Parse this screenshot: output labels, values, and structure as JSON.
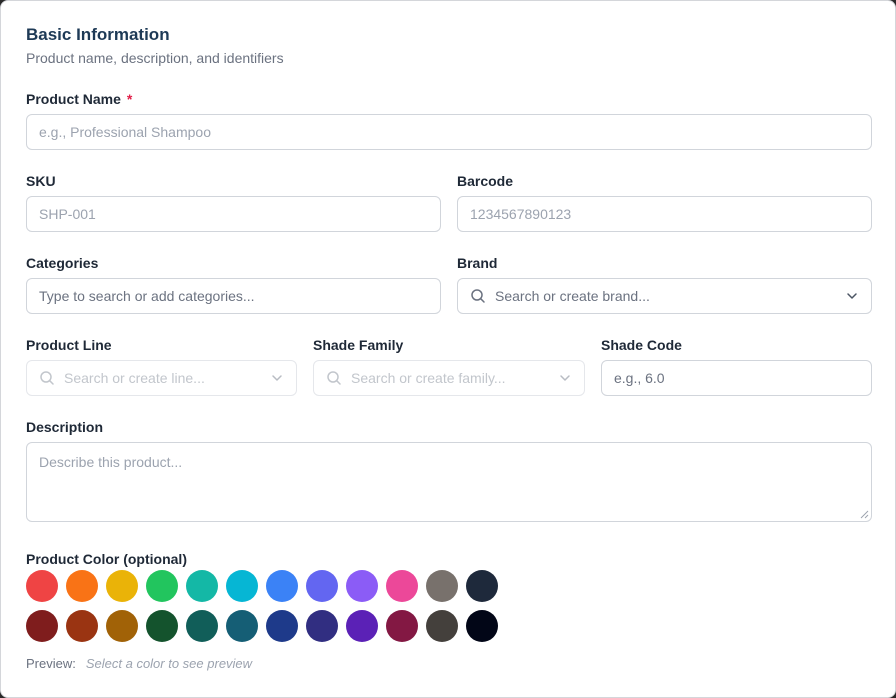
{
  "section": {
    "title": "Basic Information",
    "subtitle": "Product name, description, and identifiers"
  },
  "product_name": {
    "label": "Product Name",
    "required_mark": "*",
    "placeholder": "e.g., Professional Shampoo"
  },
  "sku": {
    "label": "SKU",
    "placeholder": "SHP-001"
  },
  "barcode": {
    "label": "Barcode",
    "placeholder": "1234567890123"
  },
  "categories": {
    "label": "Categories",
    "placeholder": "Type to search or add categories..."
  },
  "brand": {
    "label": "Brand",
    "placeholder": "Search or create brand...",
    "icon": "search-icon"
  },
  "product_line": {
    "label": "Product Line",
    "placeholder": "Search or create line...",
    "icon": "search-icon"
  },
  "shade_family": {
    "label": "Shade Family",
    "placeholder": "Search or create family...",
    "icon": "search-icon"
  },
  "shade_code": {
    "label": "Shade Code",
    "placeholder": "e.g., 6.0"
  },
  "description": {
    "label": "Description",
    "placeholder": "Describe this product..."
  },
  "product_color": {
    "label": "Product Color (optional)",
    "swatches_row1": [
      "#ef4444",
      "#f97316",
      "#eab308",
      "#22c55e",
      "#14b8a6",
      "#06b6d4",
      "#3b82f6",
      "#6366f1",
      "#8b5cf6",
      "#ec4899",
      "#78716c",
      "#1e293b"
    ],
    "swatches_row2": [
      "#7f1d1d",
      "#9a3412",
      "#a16207",
      "#14532d",
      "#115e59",
      "#155e75",
      "#1e3a8a",
      "#312e81",
      "#5b21b6",
      "#831843",
      "#44403c",
      "#020617"
    ],
    "preview_label": "Preview:",
    "preview_placeholder": "Select a color to see preview"
  }
}
